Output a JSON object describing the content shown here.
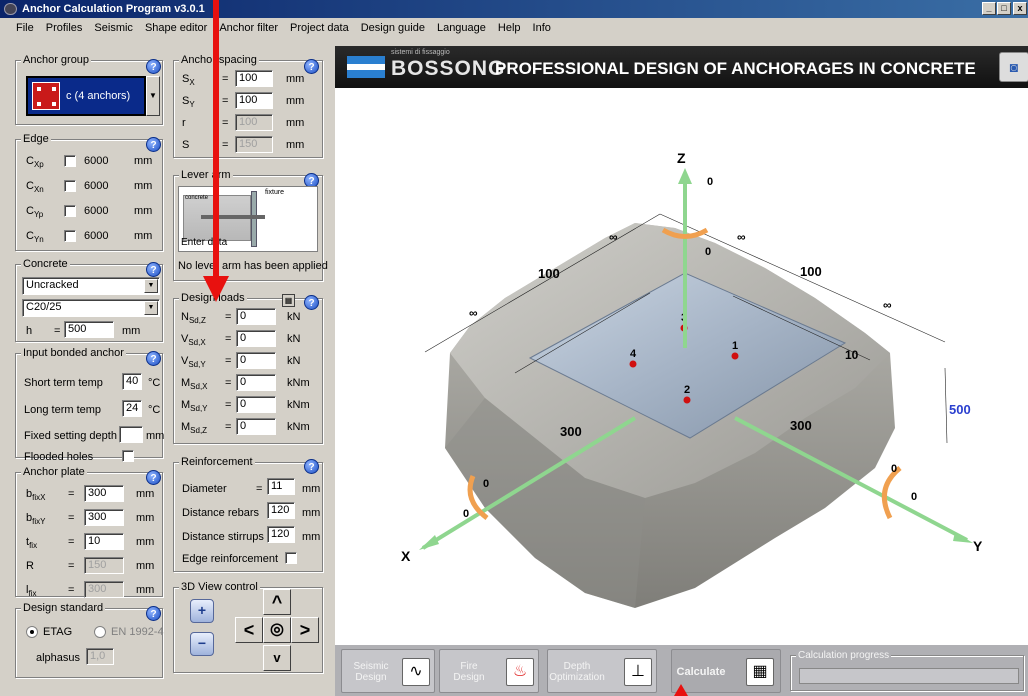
{
  "window": {
    "title": "Anchor Calculation Program v3.0.1",
    "min": "_",
    "max": "□",
    "close": "x"
  },
  "menu": [
    "File",
    "Profiles",
    "Seismic",
    "Shape editor",
    "Anchor filter",
    "Project data",
    "Design guide",
    "Language",
    "Help",
    "Info"
  ],
  "anchor_group": {
    "title": "Anchor group",
    "selected": "c (4 anchors)"
  },
  "edge": {
    "title": "Edge",
    "rows": [
      {
        "sym": "C",
        "sub": "Xp",
        "value": "6000",
        "unit": "mm"
      },
      {
        "sym": "C",
        "sub": "Xn",
        "value": "6000",
        "unit": "mm"
      },
      {
        "sym": "C",
        "sub": "Yp",
        "value": "6000",
        "unit": "mm"
      },
      {
        "sym": "C",
        "sub": "Yn",
        "value": "6000",
        "unit": "mm"
      }
    ]
  },
  "concrete": {
    "title": "Concrete",
    "state": "Uncracked",
    "grade": "C20/25",
    "h_label": "h",
    "eq": "=",
    "h_value": "500",
    "unit": "mm"
  },
  "bonded": {
    "title": "Input bonded anchor",
    "short_label": "Short term temp",
    "short_value": "40",
    "long_label": "Long term temp",
    "long_value": "24",
    "temp_unit": "°C",
    "depth_label": "Fixed setting depth",
    "depth_value": "",
    "depth_unit": "mm",
    "flooded_label": "Flooded holes"
  },
  "plate": {
    "title": "Anchor plate",
    "rows": [
      {
        "sym": "b",
        "sub": "fixX",
        "value": "300",
        "unit": "mm",
        "disabled": false
      },
      {
        "sym": "b",
        "sub": "fixY",
        "value": "300",
        "unit": "mm",
        "disabled": false
      },
      {
        "sym": "t",
        "sub": "fix",
        "value": "10",
        "unit": "mm",
        "disabled": false
      },
      {
        "sym": "R",
        "sub": "",
        "value": "150",
        "unit": "mm",
        "disabled": true
      },
      {
        "sym": "l",
        "sub": "fix",
        "value": "300",
        "unit": "mm",
        "disabled": true
      }
    ]
  },
  "standard": {
    "title": "Design standard",
    "opt1": "ETAG",
    "opt2": "EN 1992-4",
    "alphasus_label": "alphasus",
    "alphasus_value": "1,0"
  },
  "spacing": {
    "title": "Anchor spacing",
    "rows": [
      {
        "sym": "S",
        "sub": "X",
        "value": "100",
        "unit": "mm",
        "disabled": false
      },
      {
        "sym": "S",
        "sub": "Y",
        "value": "100",
        "unit": "mm",
        "disabled": false
      },
      {
        "sym": "r",
        "sub": "",
        "value": "100",
        "unit": "mm",
        "disabled": true
      },
      {
        "sym": "S",
        "sub": "",
        "value": "150",
        "unit": "mm",
        "disabled": true
      }
    ]
  },
  "lever": {
    "title": "Lever arm",
    "fixture": "fixture",
    "concrete": "concrete",
    "enter": "Enter data",
    "note": "No lever arm has been applied"
  },
  "loads": {
    "title": "Design loads",
    "rows": [
      {
        "sym": "N",
        "sub": "Sd,Z",
        "value": "0",
        "unit": "kN"
      },
      {
        "sym": "V",
        "sub": "Sd,X",
        "value": "0",
        "unit": "kN"
      },
      {
        "sym": "V",
        "sub": "Sd,Y",
        "value": "0",
        "unit": "kN"
      },
      {
        "sym": "M",
        "sub": "Sd,X",
        "value": "0",
        "unit": "kNm"
      },
      {
        "sym": "M",
        "sub": "Sd,Y",
        "value": "0",
        "unit": "kNm"
      },
      {
        "sym": "M",
        "sub": "Sd,Z",
        "value": "0",
        "unit": "kNm"
      }
    ]
  },
  "reinforcement": {
    "title": "Reinforcement",
    "diameter_label": "Diameter",
    "diameter_value": "11",
    "rebars_label": "Distance rebars",
    "rebars_value": "120",
    "stirrups_label": "Distance stirrups",
    "stirrups_value": "120",
    "edge_label": "Edge reinforcement",
    "unit": "mm"
  },
  "view_control": {
    "title": "3D View control"
  },
  "banner": {
    "brand_small": "sistemi di fissaggio",
    "brand": "BOSSONG",
    "headline": "PROFESSIONAL DESIGN OF ANCHORAGES IN CONCRETE"
  },
  "scene": {
    "axis_z": "Z",
    "axis_x": "X",
    "axis_y": "Y",
    "z_val": "0",
    "x_val": "0",
    "y_val": "0",
    "rot_val": "0",
    "dim_left": "100",
    "dim_right": "100",
    "inf": "∞",
    "plate_left": "300",
    "plate_right": "300",
    "thickness": "500",
    "ten": "10",
    "anchors": [
      "1",
      "2",
      "3",
      "4"
    ]
  },
  "bottom": {
    "seismic": "Seismic Design",
    "fire": "Fire Design",
    "depth": "Depth Optimization",
    "calculate": "Calculate",
    "progress": "Calculation progress"
  },
  "colors": {
    "arrow": "#e8110f",
    "title_bar": "#0a246a",
    "thickness": "#2a3fcf"
  }
}
